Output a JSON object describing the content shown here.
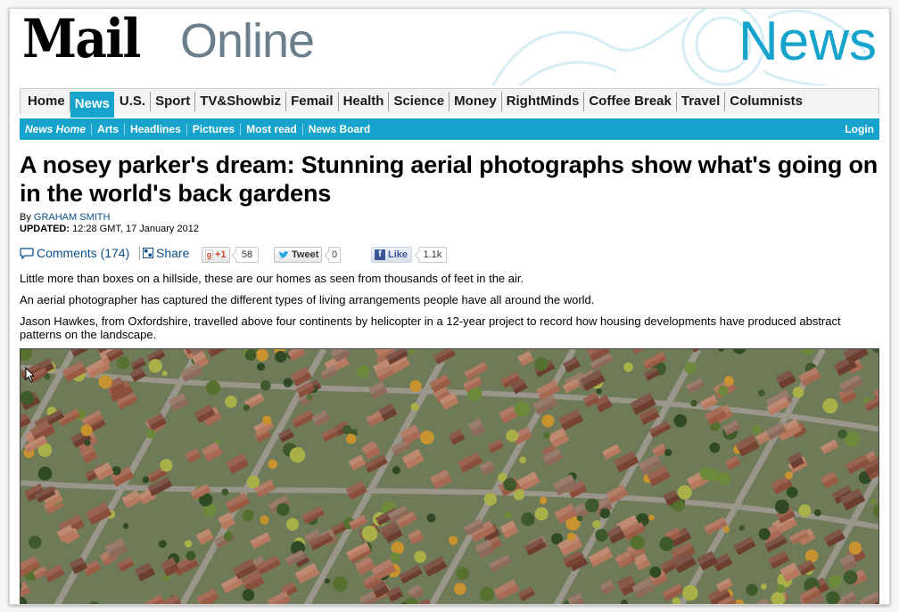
{
  "masthead": {
    "logo_mail": "Mail",
    "logo_online": "Online",
    "section": "News"
  },
  "nav": {
    "primary": [
      "Home",
      "News",
      "U.S.",
      "Sport",
      "TV&Showbiz",
      "Femail",
      "Health",
      "Science",
      "Money",
      "RightMinds",
      "Coffee Break",
      "Travel",
      "Columnists"
    ],
    "active": "News",
    "secondary": [
      "News Home",
      "Arts",
      "Headlines",
      "Pictures",
      "Most read",
      "News Board"
    ],
    "login": "Login"
  },
  "article": {
    "headline": "A nosey parker's dream: Stunning aerial photographs show what's going on in the world's back gardens",
    "byline_prefix": "By",
    "author": "GRAHAM SMITH",
    "updated_label": "UPDATED:",
    "updated_value": "12:28 GMT, 17 January 2012",
    "paragraphs": [
      "Little more than boxes on a hillside, these are our homes as seen from thousands of feet in the air.",
      "An aerial photographer has captured the different types of living arrangements people have all around the world.",
      "Jason Hawkes, from Oxfordshire, travelled above four continents by helicopter in a 12-year project to record how housing developments have produced abstract patterns on the landscape."
    ]
  },
  "share_bar": {
    "comments": "Comments (174)",
    "share": "Share",
    "gplus_label": "+1",
    "gplus_count": "58",
    "tweet_label": "Tweet",
    "tweet_count": "0",
    "like_label": "Like",
    "like_count": "1.1k"
  },
  "colors": {
    "accent": "#16a3cc",
    "link": "#0b4f8a",
    "logo_grey": "#6b7e8c"
  },
  "icons": [
    "comment-icon",
    "share-icon",
    "twitter-bird-icon",
    "facebook-icon",
    "mouse-cursor-icon"
  ]
}
